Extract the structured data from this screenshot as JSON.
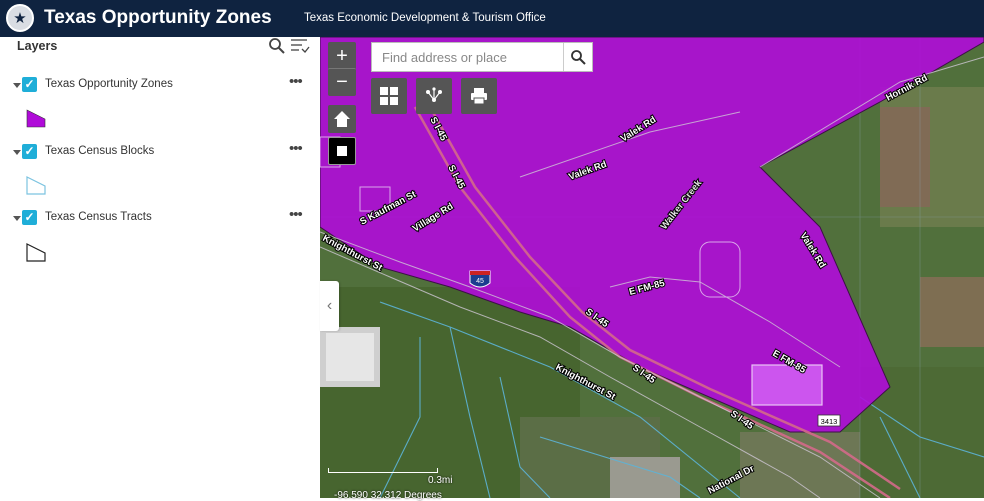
{
  "header": {
    "title": "Texas Opportunity Zones",
    "subtitle": "Texas Economic Development & Tourism Office",
    "seal_icon": "texas-seal-logo"
  },
  "panel": {
    "title": "Layers",
    "layers": [
      {
        "label": "Texas Opportunity Zones",
        "checked": true,
        "symbol": "purple-filled-polygon"
      },
      {
        "label": "Texas Census Blocks",
        "checked": true,
        "symbol": "light-blue-outline-polygon"
      },
      {
        "label": "Texas Census Tracts",
        "checked": true,
        "symbol": "black-outline-polygon"
      }
    ],
    "more_label": "•••",
    "collapse_label": "‹"
  },
  "map": {
    "search_placeholder": "Find address or place",
    "zoom_in": "+",
    "zoom_out": "−",
    "scale_label": "0.3mi",
    "coords": "-96.590 32.312 Degrees",
    "zone_color": "#b00bd9",
    "labels": {
      "valek1": "Valek Rd",
      "valek2": "Valek Rd",
      "valek3": "Valek Rd",
      "hornik": "Hornik Rd",
      "si45_1": "S I-45",
      "si45_2": "S I-45",
      "si45_3": "S I-45",
      "si45_4": "S I-45",
      "si45_5": "S I-45",
      "kaufman": "S Kaufman St",
      "village": "Village Rd",
      "knight1": "Knighthurst St",
      "knight2": "Knighthurst St",
      "walker": "Walker Creek",
      "fm85_1": "E FM-85",
      "fm85_2": "E FM-85",
      "national": "National Dr",
      "shield45": "45",
      "shield3413": "3413"
    }
  }
}
